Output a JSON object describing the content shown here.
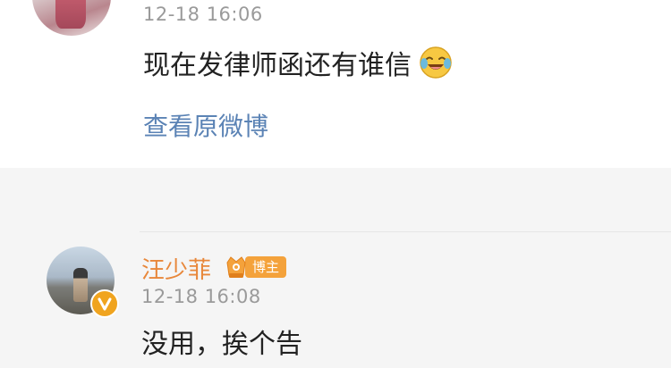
{
  "top_comment": {
    "time": "12-18 16:06",
    "text": "现在发律师函还有谁信",
    "emoji": "laughing-crying-emoji",
    "view_original_label": "查看原微博"
  },
  "bottom_comment": {
    "username": "汪少菲",
    "badge_label": "博主",
    "time": "12-18 16:08",
    "text": "没用，挨个告"
  },
  "colors": {
    "link": "#5b83b5",
    "username": "#e8873a",
    "badge": "#f4a23b",
    "timestamp": "#9a9a9a",
    "section_gray": "#f5f5f5"
  }
}
